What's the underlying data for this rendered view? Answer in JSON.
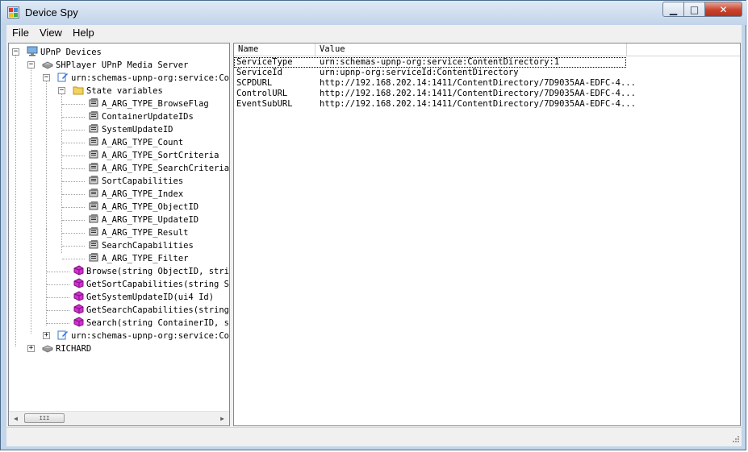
{
  "window": {
    "title": "Device Spy",
    "minimize_label": "▁",
    "maximize_label": "□",
    "close_label": "✕"
  },
  "menu": [
    "File",
    "View",
    "Help"
  ],
  "tree": {
    "root": "UPnP Devices",
    "device1": "SHPlayer UPnP Media Server",
    "service1": "urn:schemas-upnp-org:service:Cor",
    "state_folder": "State variables",
    "state_variables": [
      "A_ARG_TYPE_BrowseFlag",
      "ContainerUpdateIDs",
      "SystemUpdateID",
      "A_ARG_TYPE_Count",
      "A_ARG_TYPE_SortCriteria",
      "A_ARG_TYPE_SearchCriteria",
      "SortCapabilities",
      "A_ARG_TYPE_Index",
      "A_ARG_TYPE_ObjectID",
      "A_ARG_TYPE_UpdateID",
      "A_ARG_TYPE_Result",
      "SearchCapabilities",
      "A_ARG_TYPE_Filter"
    ],
    "actions": [
      "Browse(string ObjectID, string",
      "GetSortCapabilities(string Sc",
      "GetSystemUpdateID(ui4 Id)",
      "GetSearchCapabilities(string",
      "Search(string ContainerID, str"
    ],
    "service2": "urn:schemas-upnp-org:service:Cor",
    "device2": "RICHARD",
    "scroll_thumb": "III"
  },
  "grid": {
    "headers": [
      "Name",
      "Value"
    ],
    "rows": [
      {
        "name": "ServiceType",
        "value": "urn:schemas-upnp-org:service:ContentDirectory:1"
      },
      {
        "name": "ServiceId",
        "value": "urn:upnp-org:serviceId:ContentDirectory"
      },
      {
        "name": "SCPDURL",
        "value": "http://192.168.202.14:1411/ContentDirectory/7D9035AA-EDFC-4..."
      },
      {
        "name": "ControlURL",
        "value": "http://192.168.202.14:1411/ContentDirectory/7D9035AA-EDFC-4..."
      },
      {
        "name": "EventSubURL",
        "value": "http://192.168.202.14:1411/ContentDirectory/7D9035AA-EDFC-4..."
      }
    ]
  }
}
